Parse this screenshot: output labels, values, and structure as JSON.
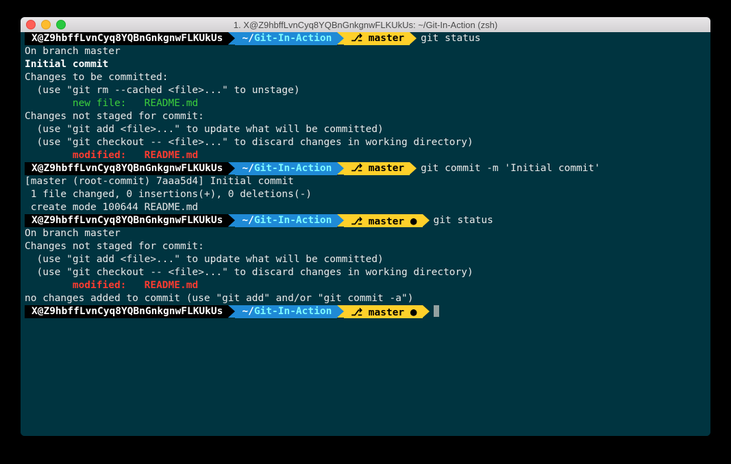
{
  "window": {
    "title": "1. X@Z9hbffLvnCyq8YQBnGnkgnwFLKUkUs: ~/Git-In-Action (zsh)"
  },
  "prompt": {
    "userhost": "X@Z9hbffLvnCyq8YQBnGnkgnwFLKUkUs",
    "path_prefix": "~/",
    "path_repo": "Git-In-Action",
    "branch_glyph": "⎇",
    "branch": "master",
    "dirty": "●"
  },
  "cmds": {
    "c1": "git status",
    "c2": "git commit -m 'Initial commit'",
    "c3": "git status"
  },
  "out": {
    "l1": "On branch master",
    "l2": "",
    "l3": "Initial commit",
    "l4": "",
    "l5": "Changes to be committed:",
    "l6": "  (use \"git rm --cached <file>...\" to unstage)",
    "l7": "",
    "l8a": "        new file:   ",
    "l8b": "README.md",
    "l9": "",
    "l10": "Changes not staged for commit:",
    "l11": "  (use \"git add <file>...\" to update what will be committed)",
    "l12": "  (use \"git checkout -- <file>...\" to discard changes in working directory)",
    "l13": "",
    "l14a": "        modified:   ",
    "l14b": "README.md",
    "l15": "",
    "c2l1": "[master (root-commit) 7aaa5d4] Initial commit",
    "c2l2": " 1 file changed, 0 insertions(+), 0 deletions(-)",
    "c2l3": " create mode 100644 README.md",
    "c3l1": "On branch master",
    "c3l2": "Changes not staged for commit:",
    "c3l3": "  (use \"git add <file>...\" to update what will be committed)",
    "c3l4": "  (use \"git checkout -- <file>...\" to discard changes in working directory)",
    "c3l5": "",
    "c3l6a": "        modified:   ",
    "c3l6b": "README.md",
    "c3l7": "",
    "c3l8": "no changes added to commit (use \"git add\" and/or \"git commit -a\")"
  }
}
